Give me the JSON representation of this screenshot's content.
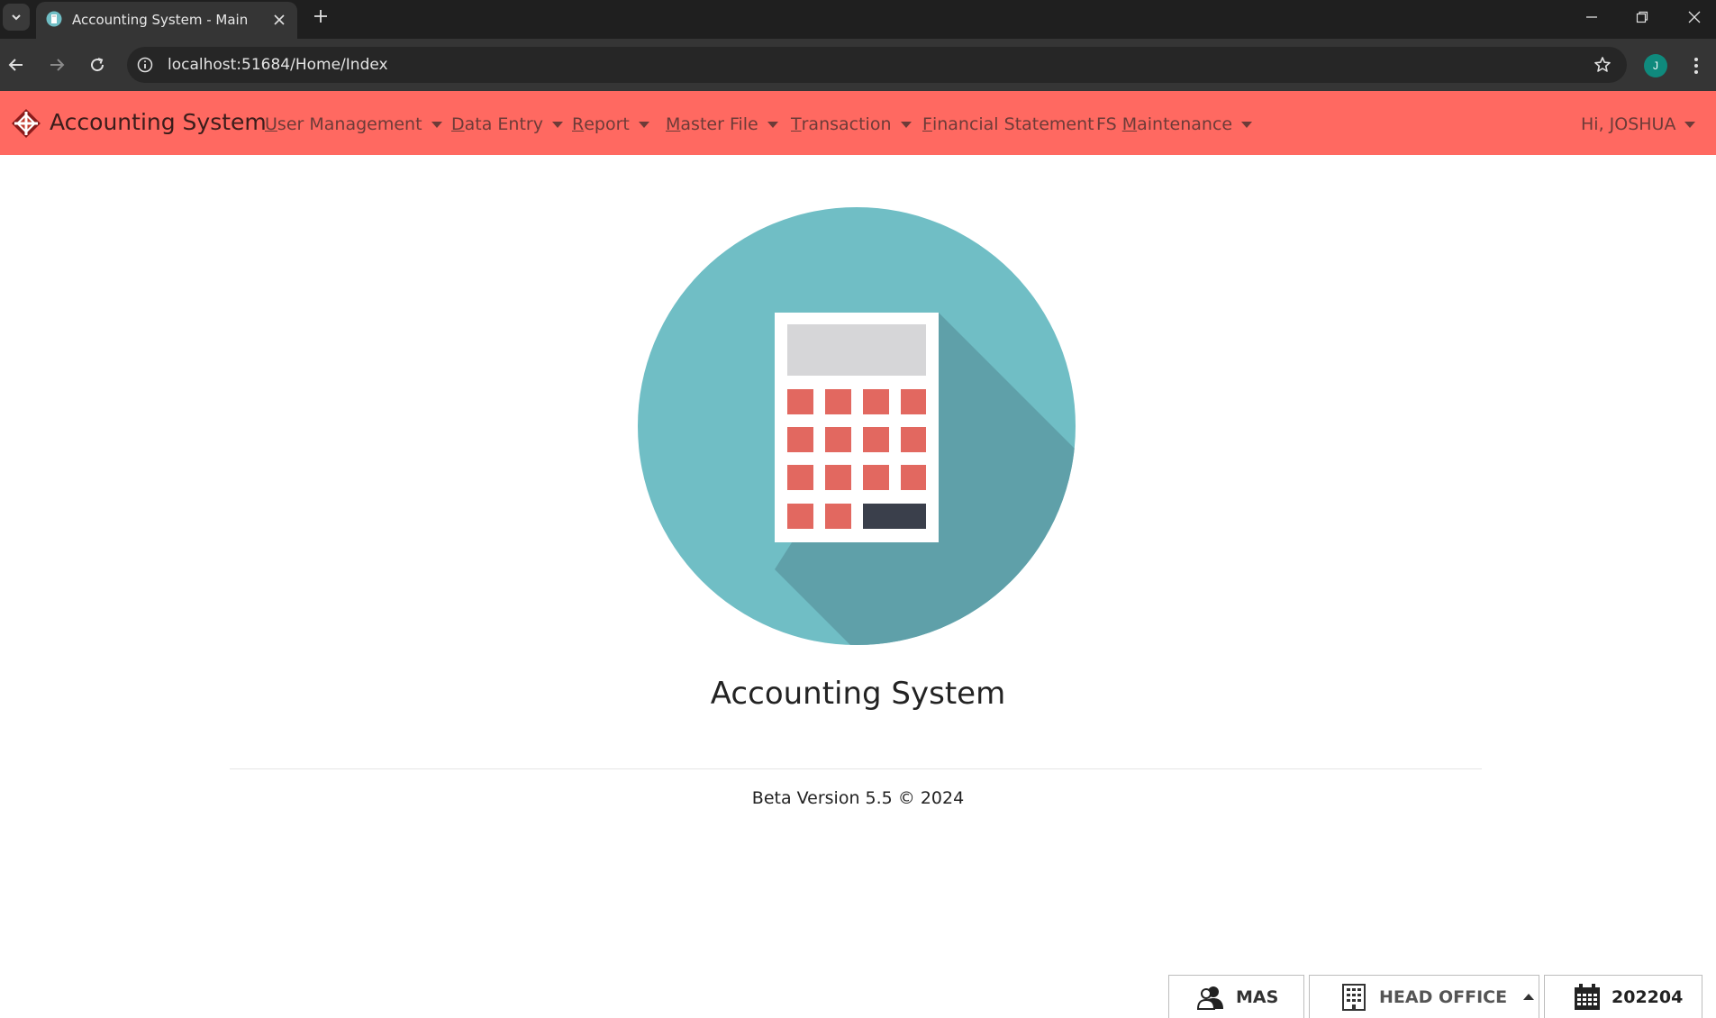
{
  "browser": {
    "tab_title": "Accounting System - Main",
    "url": "localhost:51684/Home/Index",
    "profile_initial": "J"
  },
  "navbar": {
    "brand": "Accounting System",
    "accent_color": "#ff6961",
    "menus": [
      {
        "mnemonic": "U",
        "rest": "ser Management",
        "has_dropdown": true
      },
      {
        "mnemonic": "D",
        "rest": "ata Entry",
        "has_dropdown": true
      },
      {
        "mnemonic": "R",
        "rest": "eport",
        "has_dropdown": true
      },
      {
        "mnemonic": "M",
        "rest": "aster File",
        "has_dropdown": true
      },
      {
        "mnemonic": "T",
        "rest": "ransaction",
        "has_dropdown": true
      },
      {
        "mnemonic": "F",
        "rest": "inancial Statement",
        "has_dropdown": false
      },
      {
        "prefix": "FS ",
        "mnemonic": "M",
        "rest": "aintenance",
        "has_dropdown": true
      }
    ],
    "user_greeting": "Hi, JOSHUA"
  },
  "main": {
    "logo_icon": "calculator-icon",
    "title": "Accounting System",
    "footer": "Beta Version 5.5 © 2024"
  },
  "status_bar": {
    "user_code": "MAS",
    "branch": "HEAD OFFICE",
    "period": "202204"
  }
}
